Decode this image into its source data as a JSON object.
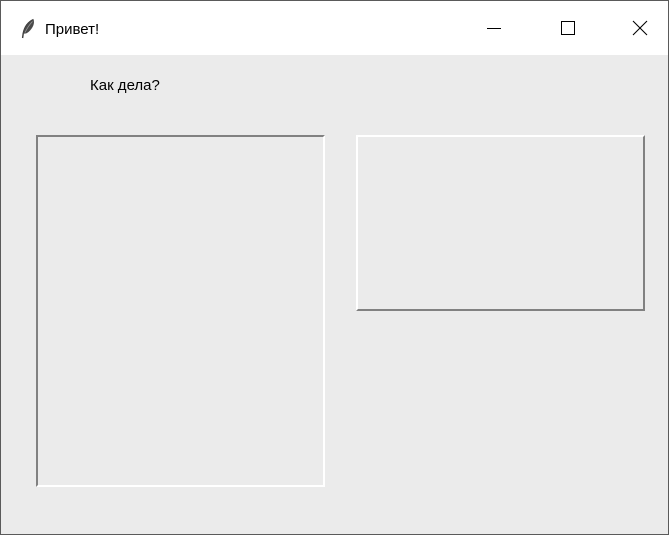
{
  "window": {
    "title": "Привет!",
    "icon": "feather-icon",
    "controls": {
      "minimize_icon": "minimize-icon",
      "maximize_icon": "maximize-icon",
      "close_icon": "close-icon"
    }
  },
  "main": {
    "label": "Как дела?"
  },
  "colors": {
    "titlebar_bg": "#ffffff",
    "client_bg": "#ebebeb",
    "border_dark": "#818181",
    "border_light": "#ffffff"
  }
}
